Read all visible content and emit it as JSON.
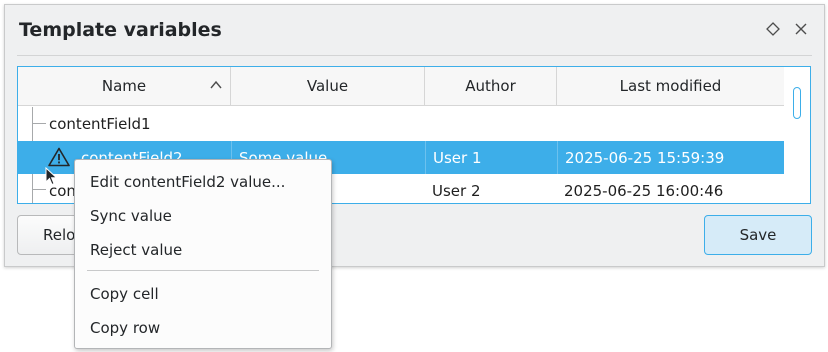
{
  "window": {
    "title": "Template variables",
    "pin_icon": "diamond-pin-icon",
    "close_icon": "close-icon"
  },
  "tree": {
    "columns": [
      "Name",
      "Value",
      "Author",
      "Last modified"
    ],
    "sort_column": "Name",
    "sort_icon": "chevron-up-icon",
    "rows": [
      {
        "name": "contentField1",
        "value": "",
        "author": "",
        "modified": ""
      },
      {
        "name": "contentField2",
        "value": "Some value",
        "author": "User 1",
        "modified": "2025-06-25 15:59:39",
        "icon": "warning-icon",
        "selected": true
      },
      {
        "name": "con",
        "value": "",
        "author": "User 2",
        "modified": "2025-06-25 16:00:46"
      }
    ],
    "colors": {
      "selection": "#3daee9",
      "focus_border": "#3daee9"
    }
  },
  "buttons": {
    "reload_visible": "Relo",
    "save": "Save"
  },
  "context_menu": {
    "items": [
      "Edit contentField2 value...",
      "Sync value",
      "Reject value",
      "Copy cell",
      "Copy row"
    ]
  }
}
